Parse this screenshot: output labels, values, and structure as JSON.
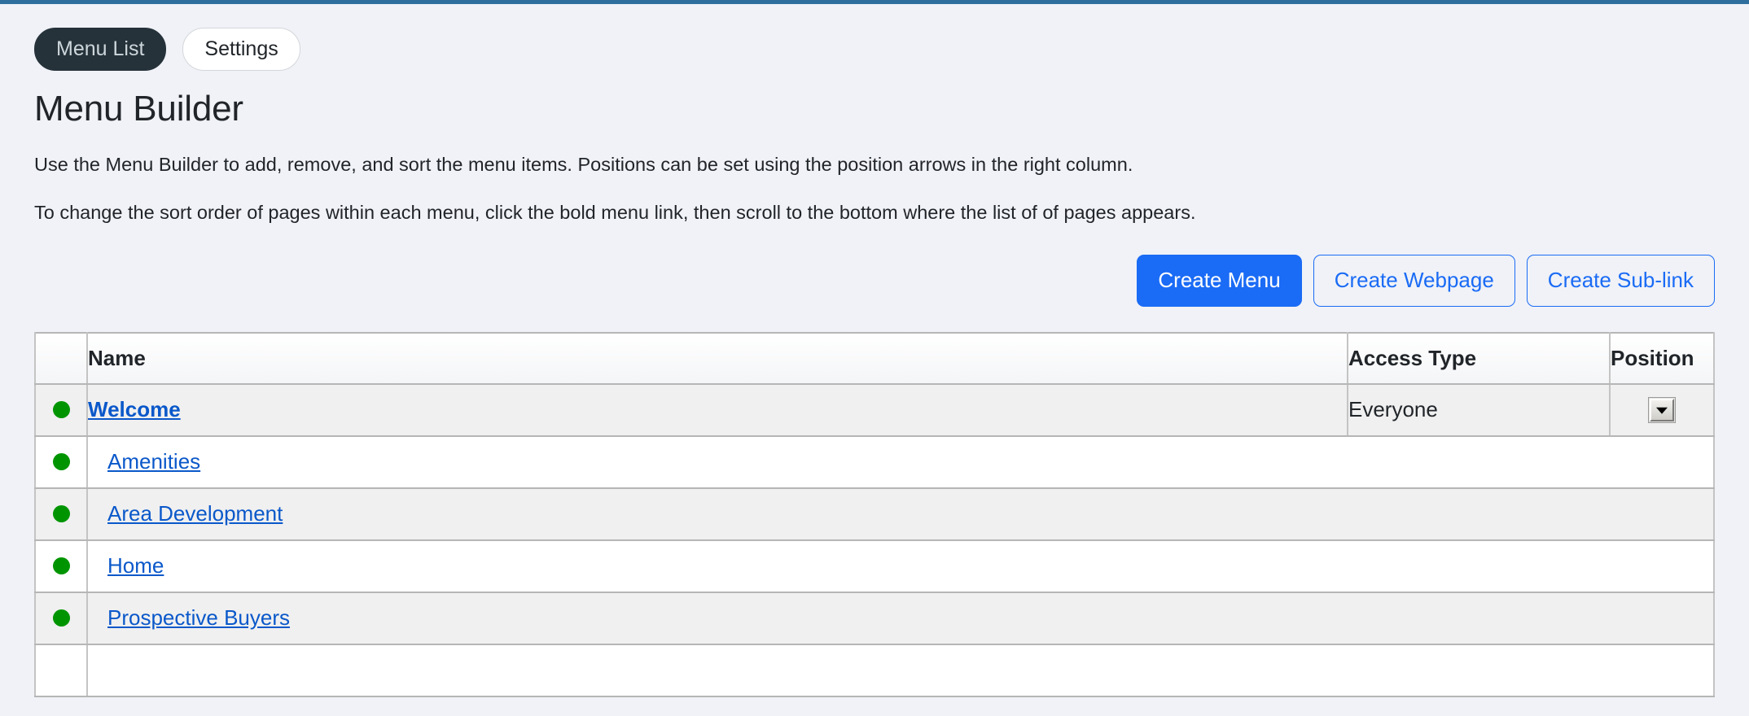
{
  "top_bar_color": "#2e6f9e",
  "tabs": [
    {
      "label": "Menu List",
      "state": "active"
    },
    {
      "label": "Settings",
      "state": "inactive"
    }
  ],
  "header": {
    "title": "Menu Builder",
    "paragraph_1": "Use the Menu Builder to add, remove, and sort the menu items. Positions can be set using the position arrows in the right column.",
    "paragraph_2": "To change the sort order of pages within each menu, click the bold menu link, then scroll to the bottom where the list of of pages appears."
  },
  "actions": {
    "create_menu": "Create Menu",
    "create_webpage": "Create Webpage",
    "create_sublink": "Create Sub-link",
    "primary_color": "#1a6bf5"
  },
  "table": {
    "columns": {
      "status": "",
      "name": "Name",
      "access_type": "Access Type",
      "position": "Position"
    },
    "status_dot_color": "#009500",
    "rows": [
      {
        "status": "active-dot",
        "name": "Welcome",
        "level": "top",
        "access_type": "Everyone",
        "position_control": "chevron-down-icon"
      },
      {
        "status": "active-dot",
        "name": "Amenities",
        "level": "sub",
        "access_type": "",
        "position_control": ""
      },
      {
        "status": "active-dot",
        "name": "Area Development",
        "level": "sub",
        "access_type": "",
        "position_control": ""
      },
      {
        "status": "active-dot",
        "name": "Home",
        "level": "sub",
        "access_type": "",
        "position_control": ""
      },
      {
        "status": "active-dot",
        "name": "Prospective Buyers",
        "level": "sub",
        "access_type": "",
        "position_control": ""
      },
      {
        "status": "",
        "name": "",
        "level": "sub",
        "access_type": "",
        "position_control": ""
      }
    ]
  }
}
